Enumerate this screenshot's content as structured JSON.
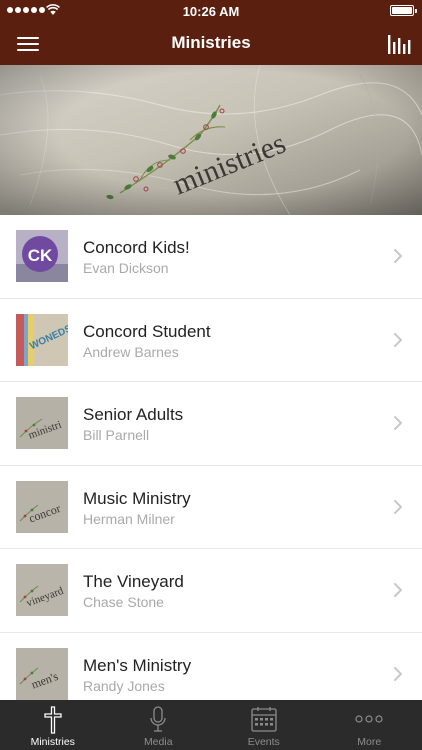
{
  "status_bar": {
    "time": "10:26 AM"
  },
  "nav": {
    "title": "Ministries"
  },
  "hero": {
    "text": "ministries"
  },
  "ministries": [
    {
      "title": "Concord Kids!",
      "leader": "Evan Dickson",
      "thumb_text": "CK"
    },
    {
      "title": "Concord Student",
      "leader": "Andrew Barnes",
      "thumb_text": "WONEDS"
    },
    {
      "title": "Senior Adults",
      "leader": "Bill Parnell",
      "thumb_text": "ministri"
    },
    {
      "title": "Music Ministry",
      "leader": "Herman Milner",
      "thumb_text": "concor"
    },
    {
      "title": "The Vineyard",
      "leader": "Chase Stone",
      "thumb_text": "vineyard"
    },
    {
      "title": "Men's Ministry",
      "leader": "Randy Jones",
      "thumb_text": "men's"
    }
  ],
  "tabs": [
    {
      "label": "Ministries",
      "icon": "cross-icon",
      "active": true
    },
    {
      "label": "Media",
      "icon": "microphone-icon",
      "active": false
    },
    {
      "label": "Events",
      "icon": "calendar-icon",
      "active": false
    },
    {
      "label": "More",
      "icon": "more-icon",
      "active": false
    }
  ],
  "colors": {
    "brand": "#5a1f0e",
    "tab_bar": "#2b2b2b",
    "subtitle": "#a9a9a9",
    "paper": "#c9c4b8"
  }
}
